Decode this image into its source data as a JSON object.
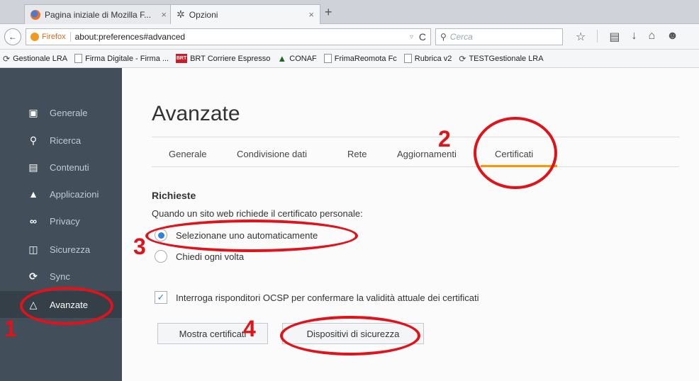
{
  "browser": {
    "tabs": [
      {
        "label": "Pagina iniziale di Mozilla F...",
        "close": "×"
      },
      {
        "label": "Opzioni",
        "close": "×"
      }
    ],
    "new_tab": "+",
    "back": "←",
    "brand": "Firefox",
    "url": "about:preferences#advanced",
    "url_dropdown": "▿",
    "reload": "C",
    "search_placeholder": "Cerca",
    "nav_icons": [
      "star-icon",
      "bookmarks-menu-icon",
      "download-icon",
      "home-icon",
      "chat-icon"
    ]
  },
  "bookmarks": [
    {
      "icon": "cycle-icon",
      "label": "Gestionale LRA"
    },
    {
      "icon": "page-icon",
      "label": "Firma Digitale - Firma ..."
    },
    {
      "icon": "brt-icon",
      "label": "BRT Corriere Espresso"
    },
    {
      "icon": "tree-icon",
      "label": "CONAF"
    },
    {
      "icon": "page-icon",
      "label": "FrimaReomota Fc"
    },
    {
      "icon": "page-icon",
      "label": "Rubrica v2"
    },
    {
      "icon": "cycle-icon",
      "label": "TESTGestionale LRA"
    }
  ],
  "sidebar": {
    "items": [
      {
        "label": "Generale",
        "icon": "general-icon"
      },
      {
        "label": "Ricerca",
        "icon": "search-icon"
      },
      {
        "label": "Contenuti",
        "icon": "content-icon"
      },
      {
        "label": "Applicazioni",
        "icon": "applications-icon"
      },
      {
        "label": "Privacy",
        "icon": "privacy-mask-icon"
      },
      {
        "label": "Sicurezza",
        "icon": "security-lock-icon"
      },
      {
        "label": "Sync",
        "icon": "sync-icon"
      },
      {
        "label": "Avanzate",
        "icon": "advanced-icon",
        "active": true
      }
    ]
  },
  "main": {
    "title": "Avanzate",
    "tabs": [
      "Generale",
      "Condivisione dati",
      "Rete",
      "Aggiornamenti",
      "Certificati"
    ],
    "selected_tab": "Certificati",
    "section_title": "Richieste",
    "section_desc": "Quando un sito web richiede il certificato personale:",
    "radio_auto": "Selezionane uno automaticamente",
    "radio_ask": "Chiedi ogni volta",
    "ocsp_label": "Interroga risponditori OCSP per confermare la validità attuale dei certificati",
    "btn_show": "Mostra certificati",
    "btn_devices": "Dispositivi di sicurezza"
  },
  "annotations": [
    "1",
    "2",
    "3",
    "4"
  ],
  "colors": {
    "annotation": "#e0121a",
    "accent_tab": "#ff9500",
    "radio_blue": "#2f82e0",
    "sidebar_bg": "#424f5a"
  }
}
